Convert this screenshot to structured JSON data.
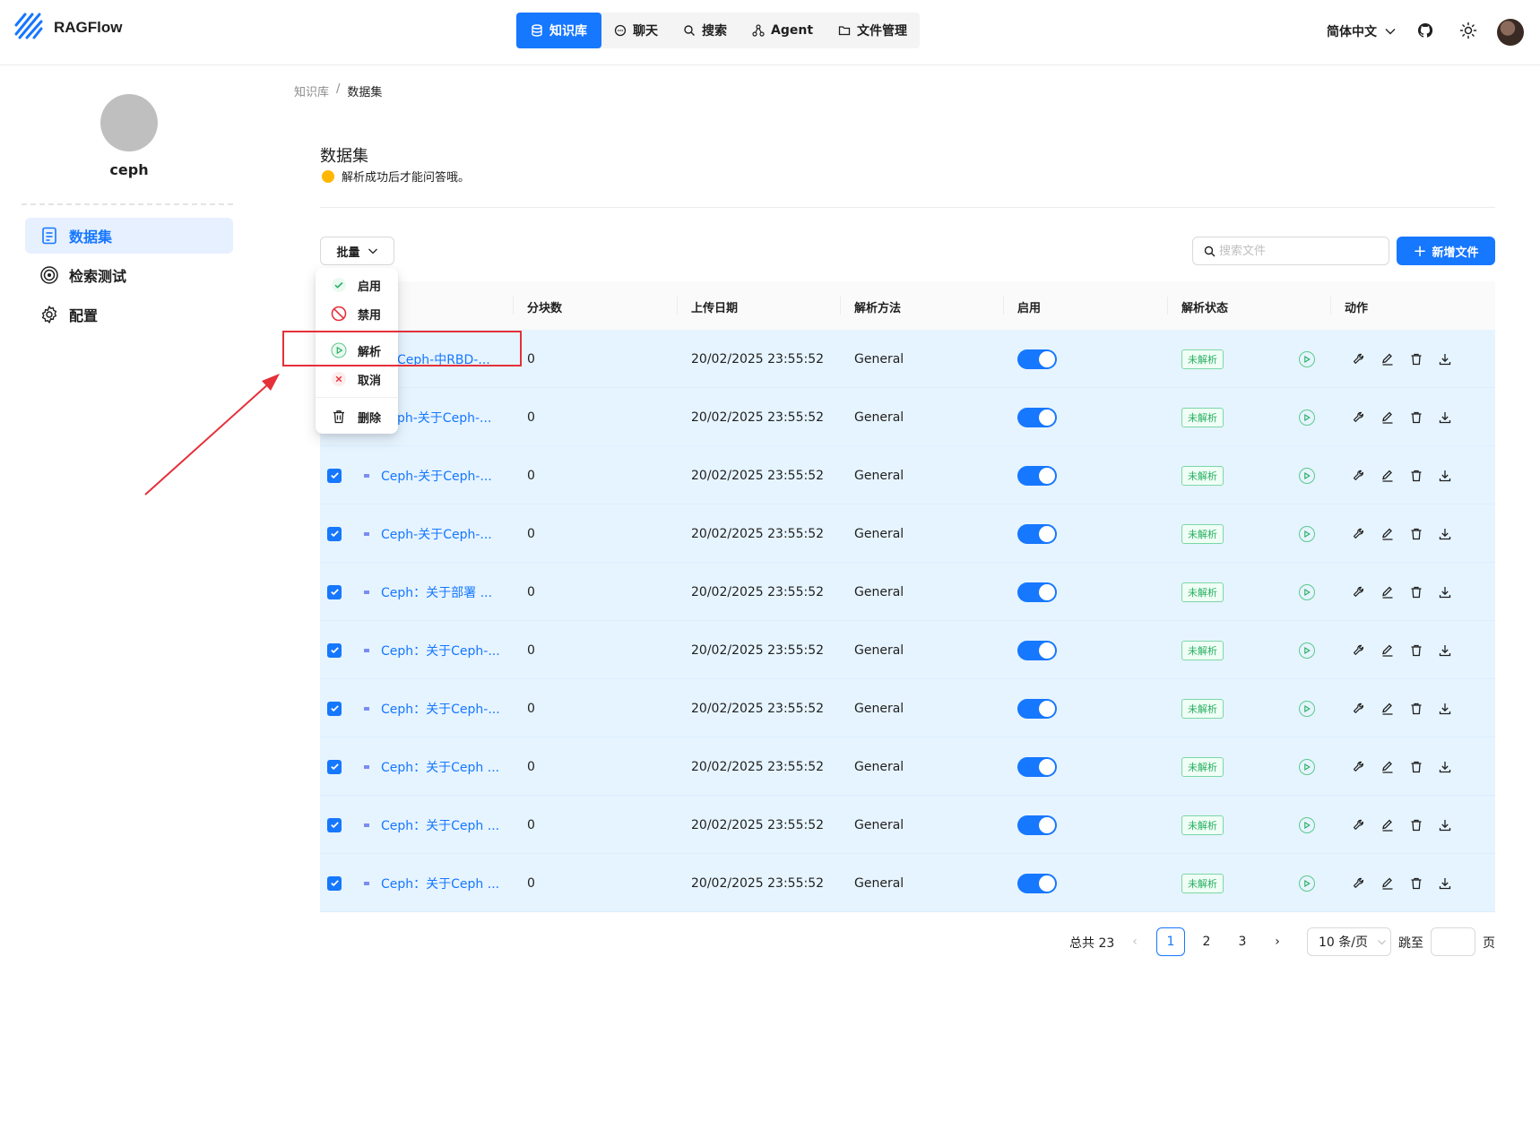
{
  "app": {
    "title": "RAGFlow"
  },
  "nav": {
    "items": [
      {
        "label": "知识库",
        "icon": "database-icon",
        "active": true
      },
      {
        "label": "聊天",
        "icon": "chat-icon",
        "active": false
      },
      {
        "label": "搜索",
        "icon": "search-icon",
        "active": false
      },
      {
        "label": "Agent",
        "icon": "agent-icon",
        "active": false
      },
      {
        "label": "文件管理",
        "icon": "folder-icon",
        "active": false
      }
    ],
    "language": "简体中文"
  },
  "sidebar": {
    "kb_name": "ceph",
    "items": [
      {
        "label": "数据集",
        "icon": "dataset-icon",
        "active": true
      },
      {
        "label": "检索测试",
        "icon": "target-icon",
        "active": false
      },
      {
        "label": "配置",
        "icon": "gear-icon",
        "active": false
      }
    ]
  },
  "breadcrumb": {
    "parent": "知识库",
    "separator": "/",
    "current": "数据集"
  },
  "page": {
    "title": "数据集",
    "tip": "解析成功后才能问答哦。"
  },
  "toolbar": {
    "batch_label": "批量",
    "search_placeholder": "搜索文件",
    "add_label": "新增文件"
  },
  "dropdown": {
    "items": [
      {
        "label": "启用",
        "icon": "check-circle-icon"
      },
      {
        "label": "禁用",
        "icon": "ban-icon"
      },
      {
        "label": "解析",
        "icon": "play-circle-icon"
      },
      {
        "label": "取消",
        "icon": "x-circle-icon"
      },
      {
        "label": "删除",
        "icon": "trash-icon"
      }
    ]
  },
  "table": {
    "columns": [
      "分块数",
      "上传日期",
      "解析方法",
      "启用",
      "解析状态",
      "动作"
    ],
    "rows": [
      {
        "name": "Ceph-中RBD-...",
        "chunks": "0",
        "date": "20/02/2025 23:55:52",
        "method": "General",
        "status": "未解析"
      },
      {
        "name": "ph-关于Ceph-...",
        "chunks": "0",
        "date": "20/02/2025 23:55:52",
        "method": "General",
        "status": "未解析"
      },
      {
        "name": "Ceph-关于Ceph-...",
        "chunks": "0",
        "date": "20/02/2025 23:55:52",
        "method": "General",
        "status": "未解析"
      },
      {
        "name": "Ceph-关于Ceph-...",
        "chunks": "0",
        "date": "20/02/2025 23:55:52",
        "method": "General",
        "status": "未解析"
      },
      {
        "name": "Ceph：关于部署 ...",
        "chunks": "0",
        "date": "20/02/2025 23:55:52",
        "method": "General",
        "status": "未解析"
      },
      {
        "name": "Ceph：关于Ceph-...",
        "chunks": "0",
        "date": "20/02/2025 23:55:52",
        "method": "General",
        "status": "未解析"
      },
      {
        "name": "Ceph：关于Ceph-...",
        "chunks": "0",
        "date": "20/02/2025 23:55:52",
        "method": "General",
        "status": "未解析"
      },
      {
        "name": "Ceph：关于Ceph ...",
        "chunks": "0",
        "date": "20/02/2025 23:55:52",
        "method": "General",
        "status": "未解析"
      },
      {
        "name": "Ceph：关于Ceph ...",
        "chunks": "0",
        "date": "20/02/2025 23:55:52",
        "method": "General",
        "status": "未解析"
      },
      {
        "name": "Ceph：关于Ceph ...",
        "chunks": "0",
        "date": "20/02/2025 23:55:52",
        "method": "General",
        "status": "未解析"
      }
    ]
  },
  "pagination": {
    "total_label": "总共 23",
    "pages": [
      "1",
      "2",
      "3"
    ],
    "current": "1",
    "prev": "‹",
    "next": "›",
    "page_size": "10 条/页",
    "jump_label": "跳至",
    "page_suffix": "页"
  },
  "colors": {
    "primary": "#1677ff",
    "selected_row": "#e6f4ff",
    "annotation": "#e5303a",
    "status_green": "#27ae60"
  }
}
